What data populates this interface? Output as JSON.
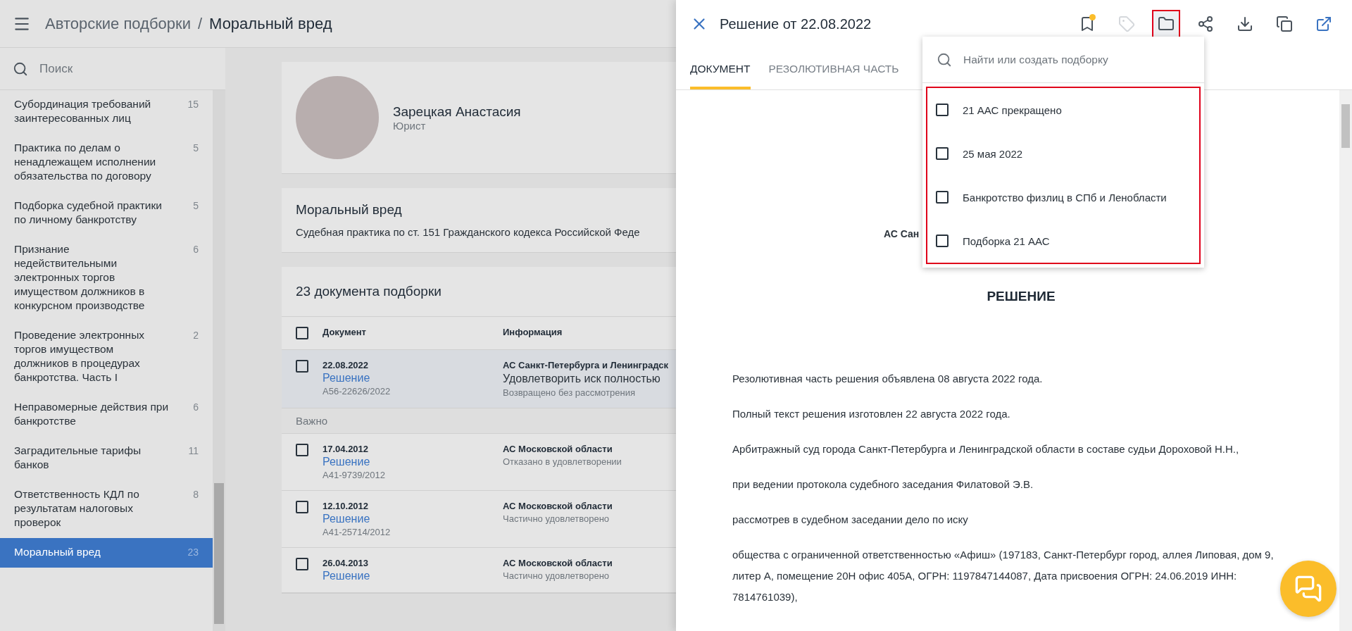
{
  "header": {
    "breadcrumb": [
      "Авторские подборки",
      "Моральный вред"
    ],
    "separator": "/"
  },
  "sidebar": {
    "search": {
      "placeholder": "Поиск"
    },
    "items": [
      {
        "label": "Субординация требований заинтересованных лиц",
        "count": "15",
        "selected": false
      },
      {
        "label": "Практика по делам о ненадлежащем исполнении обязательства по договору",
        "count": "5",
        "selected": false
      },
      {
        "label": "Подборка судебной практики по личному банкротству",
        "count": "5",
        "selected": false
      },
      {
        "label": "Признание недействительными электронных торгов имуществом должников в конкурсном производстве",
        "count": "6",
        "selected": false
      },
      {
        "label": "Проведение электронных торгов имуществом должников в процедурах банкротства. Часть I",
        "count": "2",
        "selected": false
      },
      {
        "label": "Неправомерные действия при банкротстве",
        "count": "6",
        "selected": false
      },
      {
        "label": "Заградительные тарифы банков",
        "count": "11",
        "selected": false
      },
      {
        "label": "Ответственность КДЛ по результатам налоговых проверок",
        "count": "8",
        "selected": false
      },
      {
        "label": "Моральный вред",
        "count": "23",
        "selected": true
      }
    ]
  },
  "profile": {
    "name": "Зарецкая Анастасия",
    "role": "Юрист"
  },
  "collection": {
    "title": "Моральный вред",
    "description": "Судебная практика по ст. 151 Гражданского кодекса Российской Феде"
  },
  "documents": {
    "title": "23 документа подборки",
    "columns": [
      "Документ",
      "Информация"
    ],
    "all_checked": false,
    "rows": [
      {
        "kind": "document",
        "date": "22.08.2022",
        "type": "Решение",
        "number": "А56-22626/2022",
        "court": "АС Санкт-Петербурга и Ленинградск",
        "summary": "Удовлетворить иск полностью",
        "result": "Возвращено без рассмотрения",
        "checked": false,
        "selected": true
      },
      {
        "kind": "section",
        "label": "Важно"
      },
      {
        "kind": "document",
        "date": "17.04.2012",
        "type": "Решение",
        "number": "А41-9739/2012",
        "court": "АС Московской области",
        "result": "Отказано в удовлетворении",
        "checked": false,
        "selected": false
      },
      {
        "kind": "document",
        "date": "12.10.2012",
        "type": "Решение",
        "number": "А41-25714/2012",
        "court": "АС Московской области",
        "result": "Частично удовлетворено",
        "checked": false,
        "selected": false
      },
      {
        "kind": "document",
        "date": "26.04.2013",
        "type": "Решение",
        "court": "АС Московской области",
        "result": "Частично удовлетворено",
        "checked": false,
        "selected": false
      }
    ]
  },
  "panel": {
    "title": "Решение от 22.08.2022",
    "actions": [
      {
        "kind": "bookmark",
        "dot": true,
        "disabled": false,
        "selected": false
      },
      {
        "kind": "tag",
        "dot": false,
        "disabled": true,
        "selected": false
      },
      {
        "kind": "folder",
        "dot": false,
        "disabled": false,
        "selected": true
      },
      {
        "kind": "share",
        "dot": false,
        "disabled": false,
        "selected": false
      },
      {
        "kind": "download",
        "dot": false,
        "disabled": false,
        "selected": false
      },
      {
        "kind": "copy",
        "dot": false,
        "disabled": false,
        "selected": false
      },
      {
        "kind": "open",
        "dot": false,
        "disabled": false,
        "selected": false
      }
    ],
    "tabs": [
      {
        "label": "ДОКУМЕНТ",
        "selected": true
      },
      {
        "label": "РЕЗОЛЮТИВНАЯ ЧАСТЬ",
        "selected": false
      }
    ],
    "dropdown": {
      "search": {
        "placeholder": "Найти или создать подборку"
      },
      "items": [
        {
          "label": "21 ААС прекращено",
          "checked": false
        },
        {
          "label": "25 мая 2022",
          "checked": false
        },
        {
          "label": "Банкротство физлиц в СПб и Ленобласти",
          "checked": false
        },
        {
          "label": "Подборка 21 ААС",
          "checked": false
        }
      ]
    },
    "document": {
      "court": "АС Сан",
      "heading": "РЕШЕНИЕ",
      "paragraphs": [
        "Резолютивная часть решения объявлена 08 августа 2022 года.",
        "Полный текст решения изготовлен 22 августа 2022 года.",
        "Арбитражный суд города Санкт-Петербурга и Ленинградской области в составе судьи Дороховой Н.Н.,",
        "при ведении протокола судебного заседания Филатовой Э.В.",
        "рассмотрев в судебном заседании дело по иску",
        "общества с ограниченной ответственностью «Афиш» (197183, Санкт-Петербург город, аллея Липовая, дом 9, литер А, помещение 20Н офис 405А, ОГРН: 1197847144087, Дата присвоения ОГРН: 24.06.2019 ИНН: 7814761039),"
      ]
    }
  }
}
